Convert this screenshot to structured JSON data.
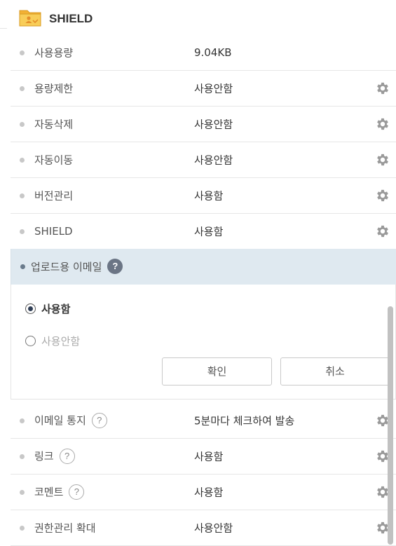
{
  "header": {
    "title": "SHIELD",
    "icon": "folder-user-icon"
  },
  "rows_top": [
    {
      "label": "사용용량",
      "value": "9.04KB",
      "gear": false,
      "help": false
    },
    {
      "label": "용량제한",
      "value": "사용안함",
      "gear": true,
      "help": false
    },
    {
      "label": "자동삭제",
      "value": "사용안함",
      "gear": true,
      "help": false
    },
    {
      "label": "자동이동",
      "value": "사용안함",
      "gear": true,
      "help": false
    },
    {
      "label": "버전관리",
      "value": "사용함",
      "gear": true,
      "help": false
    },
    {
      "label": "SHIELD",
      "value": "사용함",
      "gear": true,
      "help": false
    }
  ],
  "expanded": {
    "label": "업로드용 이메일",
    "help_glyph": "?",
    "options": [
      {
        "label": "사용함",
        "selected": true
      },
      {
        "label": "사용안함",
        "selected": false
      }
    ],
    "confirm_label": "확인",
    "cancel_label": "취소"
  },
  "rows_bottom": [
    {
      "label": "이메일 통지",
      "value": "5분마다 체크하여 발송",
      "gear": true,
      "help": true
    },
    {
      "label": "링크",
      "value": "사용함",
      "gear": true,
      "help": true
    },
    {
      "label": "코멘트",
      "value": "사용함",
      "gear": true,
      "help": true
    },
    {
      "label": "권한관리 확대",
      "value": "사용안함",
      "gear": true,
      "help": false
    }
  ],
  "help_glyph": "?",
  "colors": {
    "accent": "#2f3e55",
    "selected_row_bg": "#dfe9f0",
    "folder": "#f5c441"
  }
}
